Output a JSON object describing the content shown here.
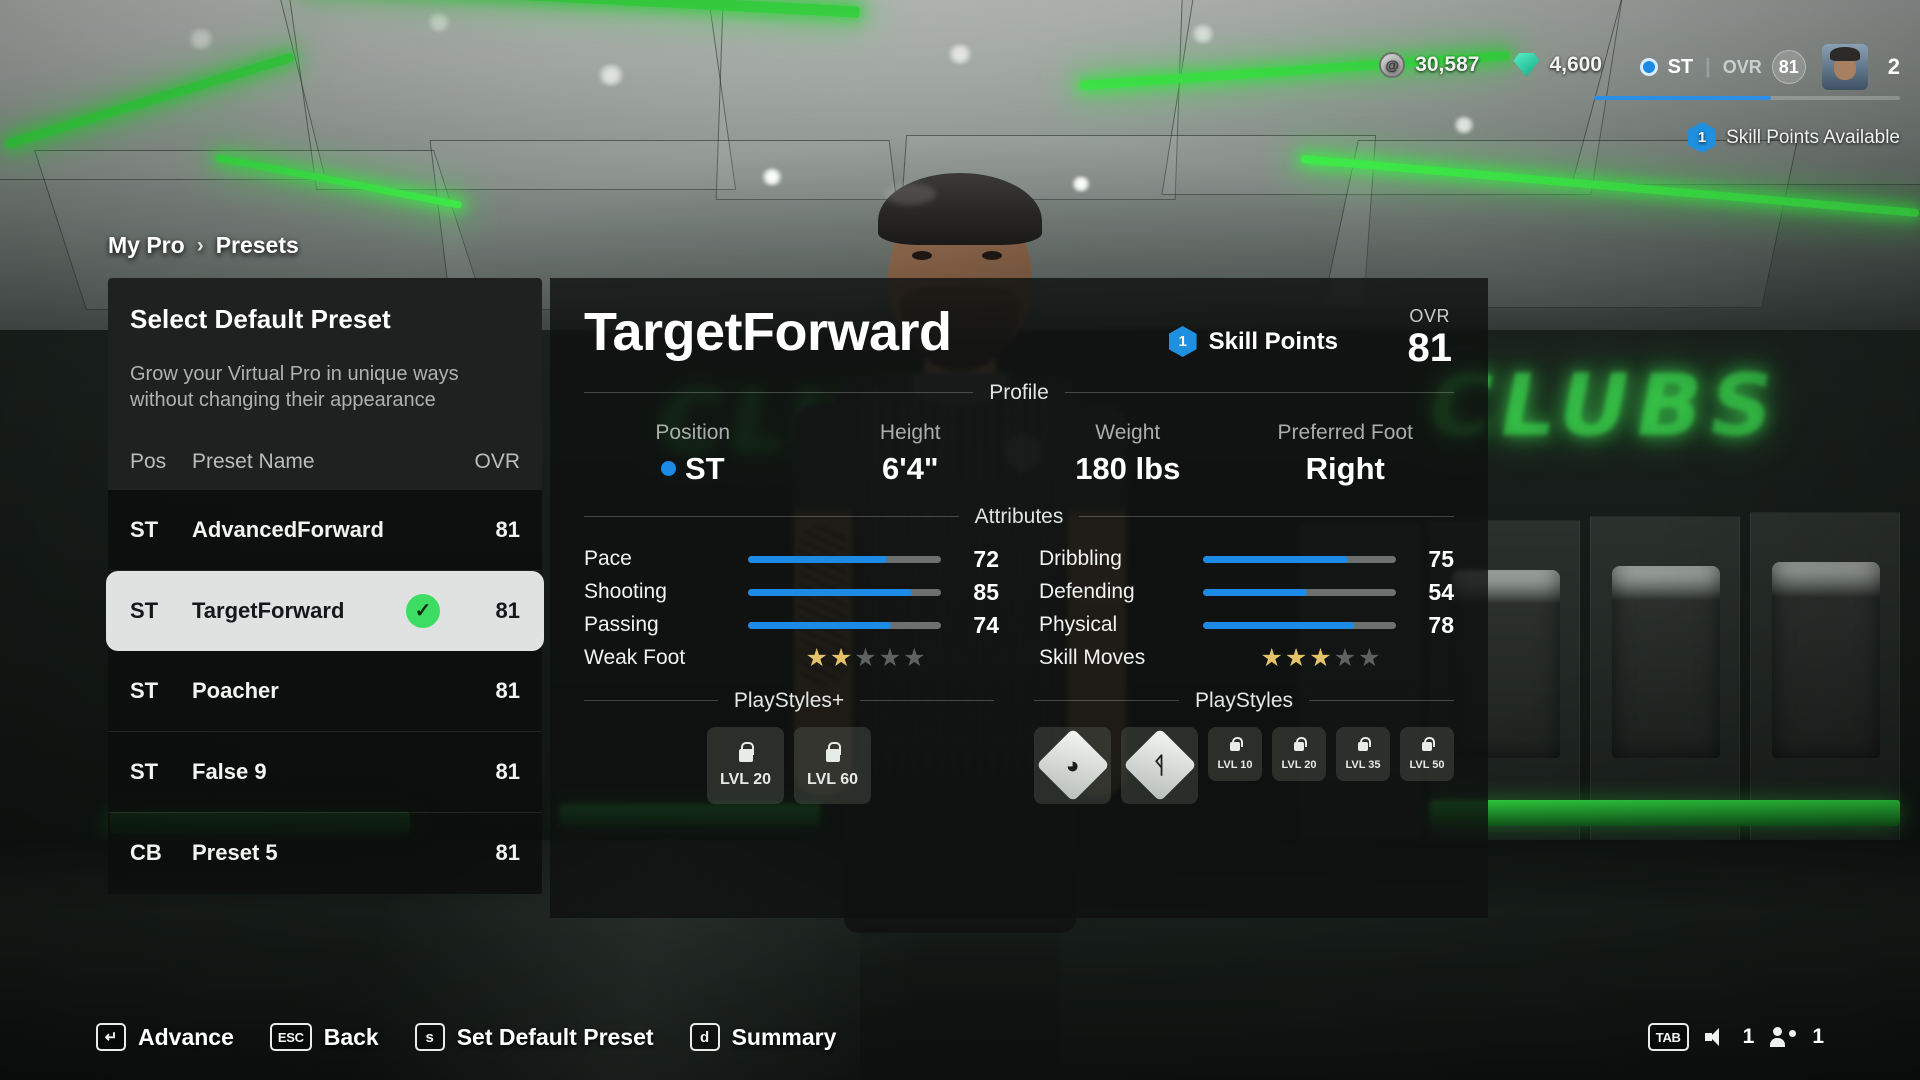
{
  "hud": {
    "coins": "30,587",
    "gems": "4,600",
    "position": "ST",
    "divider": "|",
    "ovr_label": "OVR",
    "ovr_value": "81",
    "level": "2",
    "skill_points_count": "1",
    "skill_points_label": "Skill Points Available",
    "coin_icon": "coin-icon",
    "gem_icon": "gem-icon"
  },
  "breadcrumb": {
    "root": "My Pro",
    "separator": "›",
    "current": "Presets"
  },
  "preset_panel": {
    "title": "Select Default Preset",
    "description": "Grow your Virtual Pro in unique ways without changing their appearance",
    "columns": {
      "pos": "Pos",
      "name": "Preset Name",
      "ovr": "OVR"
    },
    "rows": [
      {
        "pos": "ST",
        "name": "AdvancedForward",
        "ovr": "81",
        "selected": false,
        "default": false
      },
      {
        "pos": "ST",
        "name": "TargetForward",
        "ovr": "81",
        "selected": true,
        "default": true
      },
      {
        "pos": "ST",
        "name": "Poacher",
        "ovr": "81",
        "selected": false,
        "default": false
      },
      {
        "pos": "ST",
        "name": "False 9",
        "ovr": "81",
        "selected": false,
        "default": false
      },
      {
        "pos": "CB",
        "name": "Preset 5",
        "ovr": "81",
        "selected": false,
        "default": false
      }
    ],
    "check_glyph": "✓"
  },
  "detail": {
    "name": "TargetForward",
    "skill_points_count": "1",
    "skill_points_label": "Skill Points",
    "ovr_label": "OVR",
    "ovr_value": "81",
    "profile_header": "Profile",
    "profile": [
      {
        "label": "Position",
        "value": "ST",
        "has_dot": true
      },
      {
        "label": "Height",
        "value": "6'4\"",
        "has_dot": false
      },
      {
        "label": "Weight",
        "value": "180 lbs",
        "has_dot": false
      },
      {
        "label": "Preferred Foot",
        "value": "Right",
        "has_dot": false
      }
    ],
    "attributes_header": "Attributes",
    "attributes_left": [
      {
        "name": "Pace",
        "value": "72"
      },
      {
        "name": "Shooting",
        "value": "85"
      },
      {
        "name": "Passing",
        "value": "74"
      }
    ],
    "attributes_right": [
      {
        "name": "Dribbling",
        "value": "75"
      },
      {
        "name": "Defending",
        "value": "54"
      },
      {
        "name": "Physical",
        "value": "78"
      }
    ],
    "weak_foot": {
      "label": "Weak Foot",
      "filled": 2,
      "total": 5
    },
    "skill_moves": {
      "label": "Skill Moves",
      "filled": 3,
      "total": 5
    },
    "playstyles_plus": {
      "header": "PlayStyles+",
      "tiles": [
        {
          "type": "locked",
          "lvl": "LVL 20"
        },
        {
          "type": "locked",
          "lvl": "LVL 60"
        }
      ]
    },
    "playstyles": {
      "header": "PlayStyles",
      "tiles": [
        {
          "type": "unlocked",
          "icon": "power-header-icon",
          "glyph": "◕"
        },
        {
          "type": "unlocked",
          "icon": "magnet-icon",
          "glyph": "ᛩ"
        },
        {
          "type": "locked",
          "lvl": "LVL 10"
        },
        {
          "type": "locked",
          "lvl": "LVL 20"
        },
        {
          "type": "locked",
          "lvl": "LVL 35"
        },
        {
          "type": "locked",
          "lvl": "LVL 50"
        }
      ]
    }
  },
  "actionbar": {
    "actions": [
      {
        "key": "↵",
        "label": "Advance",
        "wide": false
      },
      {
        "key": "ESC",
        "label": "Back",
        "wide": true
      },
      {
        "key": "s",
        "label": "Set Default Preset",
        "wide": false
      },
      {
        "key": "d",
        "label": "Summary",
        "wide": false
      }
    ],
    "right": {
      "tab_key": "TAB",
      "voice_count": "1",
      "party_count": "1"
    }
  },
  "background": {
    "wall_logo": "CLUBS"
  },
  "colors": {
    "accent_blue": "#1d8ae6",
    "accent_green": "#3ddd63",
    "neon_green": "#3ff04a",
    "star_gold": "#e3c269",
    "selected_row_bg": "#dfe2e0"
  }
}
